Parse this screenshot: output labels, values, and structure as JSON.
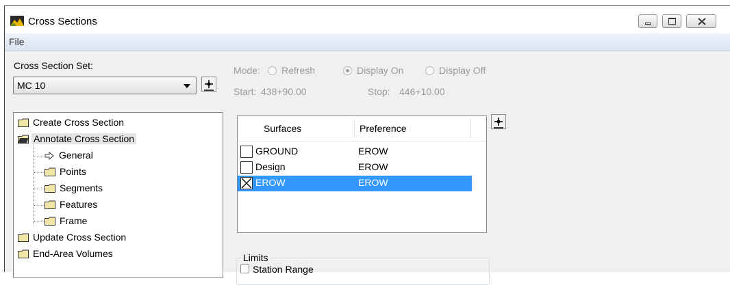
{
  "window": {
    "title": "Cross Sections"
  },
  "menu": {
    "file": "File"
  },
  "set": {
    "label": "Cross Section Set:",
    "value": "MC 10"
  },
  "mode": {
    "label": "Mode:",
    "options": [
      "Refresh",
      "Display On",
      "Display Off"
    ],
    "selected": "Display On"
  },
  "range": {
    "start_label": "Start:",
    "start_value": "438+90.00",
    "stop_label": "Stop:",
    "stop_value": "446+10.00"
  },
  "tree": {
    "create": "Create Cross Section",
    "annotate": "Annotate Cross Section",
    "general": "General",
    "points": "Points",
    "segments": "Segments",
    "features": "Features",
    "frame": "Frame",
    "update": "Update Cross Section",
    "volumes": "End-Area Volumes"
  },
  "surfaces": {
    "columns": [
      "Surfaces",
      "Preference"
    ],
    "rows": [
      {
        "name": "GROUND",
        "pref": "EROW",
        "checked": false
      },
      {
        "name": "Design",
        "pref": "EROW",
        "checked": false
      },
      {
        "name": "EROW",
        "pref": "EROW",
        "checked": true
      }
    ]
  },
  "limits": {
    "title": "Limits",
    "station_range": "Station Range"
  },
  "colors": {
    "selection": "#3399ff",
    "disabled_text": "#9a9a9a",
    "menubar": "#dbe4f3"
  }
}
